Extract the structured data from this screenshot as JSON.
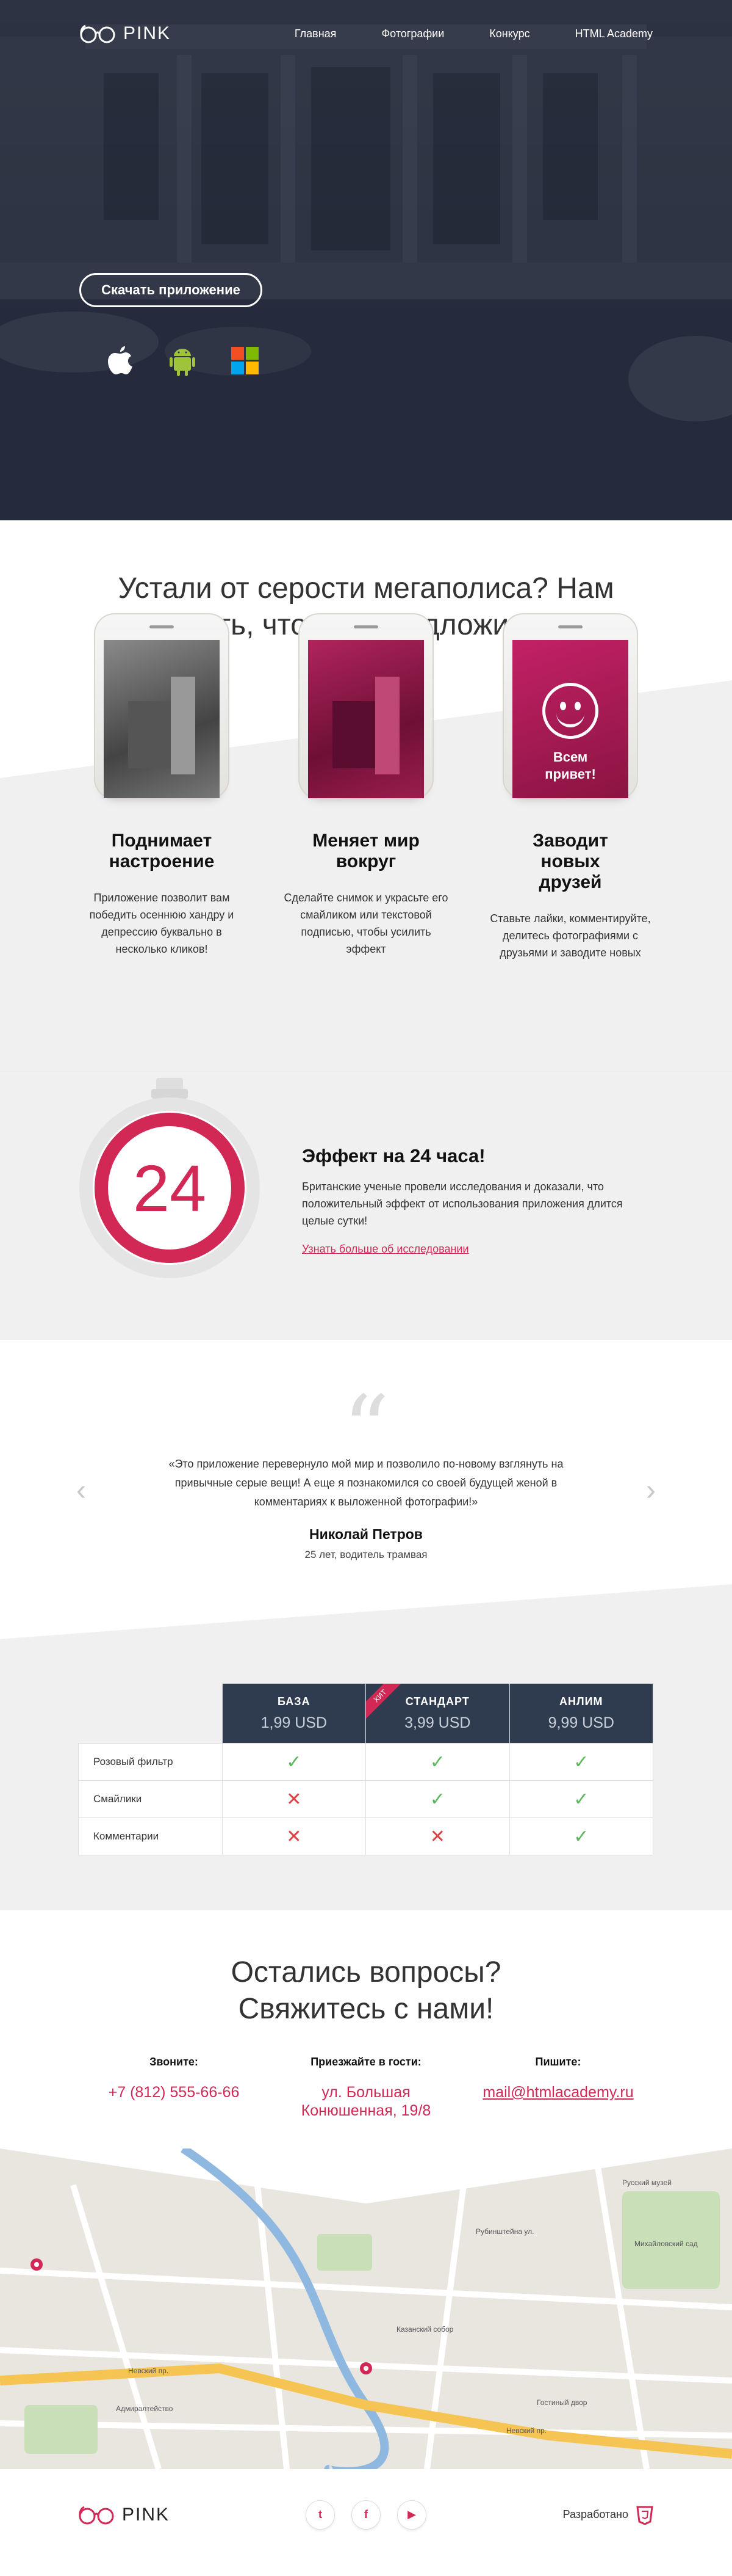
{
  "header": {
    "logo_text": "PINK",
    "nav": [
      "Главная",
      "Фотографии",
      "Конкурс",
      "HTML Academy"
    ]
  },
  "hero": {
    "download_label": "Скачать приложение",
    "platforms": [
      "apple-icon",
      "android-icon",
      "windows-icon"
    ]
  },
  "intro": {
    "title": "Устали от серости мегаполиса? Нам есть, что вам предложить!"
  },
  "features": {
    "phone3_text": "Всем привет!",
    "items": [
      {
        "title": "Поднимает настроение",
        "text": "Приложение позволит вам победить осеннюю хандру и депрессию буквально в несколько кликов!"
      },
      {
        "title": "Меняет мир вокруг",
        "text": "Сделайте снимок и украсьте его смайликом или текстовой подписью, чтобы усилить эффект"
      },
      {
        "title": "Заводит новых друзей",
        "text": "Ставьте лайки, комментируйте, делитесь фотографиями с друзьями и заводите новых"
      }
    ]
  },
  "effect": {
    "number": "24",
    "title": "Эффект на 24 часа!",
    "text": "Британские ученые провели исследования и доказали, что положительный эффект от использования приложения длится целые сутки!",
    "link": "Узнать больше об исследовании"
  },
  "review": {
    "quote_mark": "“",
    "text": "«Это приложение перевернуло мой мир и позволило по-новому взглянуть на привычные серые вещи! А еще я познакомился со своей будущей женой в комментариях к выложенной фотографии!»",
    "author": "Николай Петров",
    "role": "25 лет, водитель трамвая",
    "prev": "‹",
    "next": "›"
  },
  "pricing": {
    "plans": [
      {
        "name": "БАЗА",
        "price": "1,99 USD"
      },
      {
        "name": "СТАНДАРТ",
        "price": "3,99 USD",
        "badge": "ХИТ"
      },
      {
        "name": "АНЛИМ",
        "price": "9,99 USD"
      }
    ],
    "rows": [
      {
        "label": "Розовый фильтр",
        "values": [
          true,
          true,
          true
        ]
      },
      {
        "label": "Смайлики",
        "values": [
          false,
          true,
          true
        ]
      },
      {
        "label": "Комментарии",
        "values": [
          false,
          false,
          true
        ]
      }
    ],
    "check": "✓",
    "cross": "✕"
  },
  "contacts": {
    "title": "Остались вопросы? Свяжитесь с нами!",
    "phone_label": "Звоните:",
    "phone": "+7 (812) 555-66-66",
    "address_label": "Приезжайте в гости:",
    "address": "ул. Большая Конюшенная, 19/8",
    "email_label": "Пишите:",
    "email": "mail@htmlacademy.ru"
  },
  "map": {
    "labels": [
      "Невский пр.",
      "Невский пр.",
      "Русский музей",
      "Михайловский сад",
      "Адмиралтейство",
      "Казанский собор",
      "Гостиный двор",
      "Рубинштейна ул."
    ]
  },
  "footer": {
    "logo_text": "PINK",
    "social": [
      "t",
      "f",
      "▶"
    ],
    "credits": "Разработано"
  }
}
